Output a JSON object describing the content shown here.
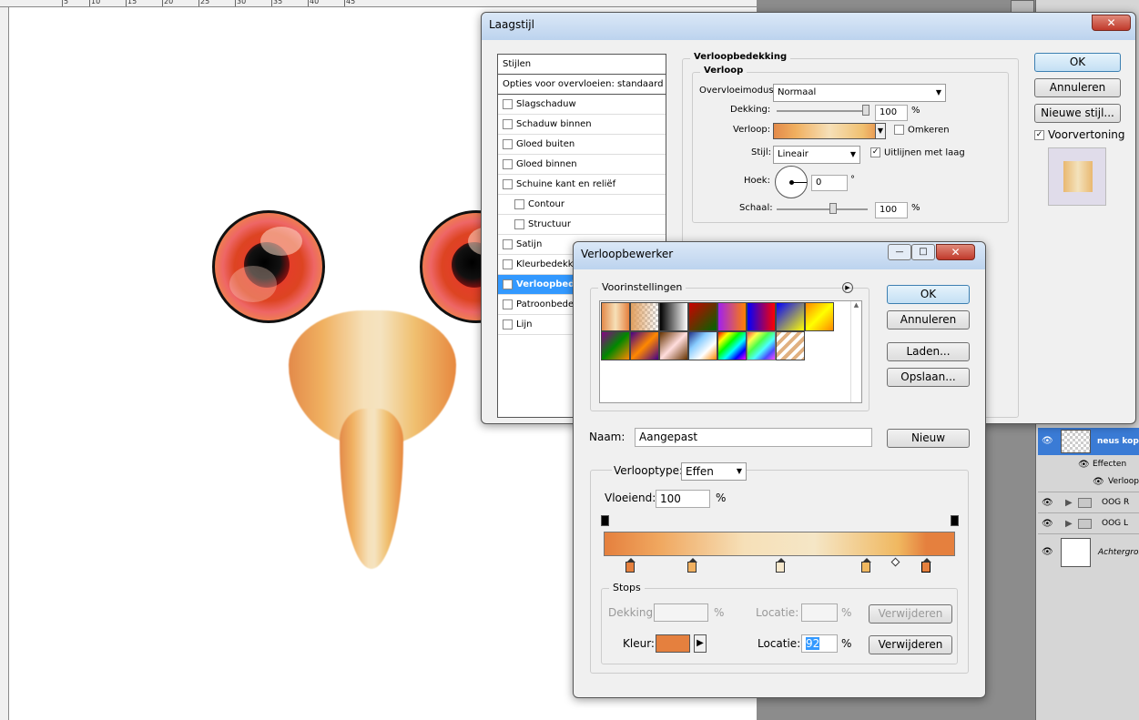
{
  "ruler": {
    "ticks": [
      "0",
      "5",
      "10",
      "15",
      "20",
      "25",
      "30",
      "35",
      "40",
      "45"
    ]
  },
  "layer_style": {
    "title": "Laagstijl",
    "close_glyph": "✕",
    "styles_header": "Stijlen",
    "blend_options": "Opties voor overvloeien: standaard",
    "items": [
      "Slagschaduw",
      "Schaduw binnen",
      "Gloed buiten",
      "Gloed binnen",
      "Schuine kant en reliëf",
      "Contour",
      "Structuur",
      "Satijn",
      "Kleurbedekking",
      "Verloopbedekking",
      "Patroonbedekking",
      "Lijn"
    ],
    "item_checked": [
      "",
      "",
      "",
      "",
      "",
      "",
      "",
      "",
      "",
      "✓",
      "",
      ""
    ],
    "section_title": "Verloopbedekking",
    "group_title": "Verloop",
    "blend_mode_label": "Overvloeimodus:",
    "blend_mode_value": "Normaal",
    "opacity_label": "Dekking:",
    "opacity_value": "100",
    "percent": "%",
    "gradient_label": "Verloop:",
    "reverse_label": "Omkeren",
    "style_label": "Stijl:",
    "style_value": "Lineair",
    "align_label": "Uitlijnen met laag",
    "align_check": "✓",
    "angle_label": "Hoek:",
    "angle_value": "0",
    "degree": "°",
    "scale_label": "Schaal:",
    "scale_value": "100",
    "ok": "OK",
    "cancel": "Annuleren",
    "new_style": "Nieuwe stijl...",
    "preview_label": "Voorvertoning",
    "preview_check": "✓"
  },
  "gradient_editor": {
    "title": "Verloopbewerker",
    "min_glyph": "—",
    "max_glyph": "□",
    "close_glyph": "✕",
    "presets_label": "Voorinstellingen",
    "ok": "OK",
    "cancel": "Annuleren",
    "load": "Laden...",
    "save": "Opslaan...",
    "name_label": "Naam:",
    "name_value": "Aangepast",
    "new": "Nieuw",
    "type_label": "Verlooptype:",
    "type_value": "Effen",
    "smooth_label": "Vloeiend:",
    "smooth_value": "100",
    "percent": "%",
    "stops_label": "Stops",
    "opacity_label": "Dekking:",
    "location_label": "Locatie:",
    "delete": "Verwijderen",
    "color_label": "Kleur:",
    "location_value": "92",
    "stop_color": "#e5803e"
  },
  "layers": {
    "rows": [
      {
        "name": "neus kop",
        "eye": "👁"
      },
      {
        "name": "Effecten",
        "eye": "👁"
      },
      {
        "name": "Verloop",
        "eye": "👁"
      },
      {
        "name": "OOG R",
        "eye": "👁",
        "arrow": "▶"
      },
      {
        "name": "OOG L",
        "eye": "👁",
        "arrow": "▶"
      },
      {
        "name": "Achtergrond",
        "eye": "👁"
      }
    ]
  }
}
